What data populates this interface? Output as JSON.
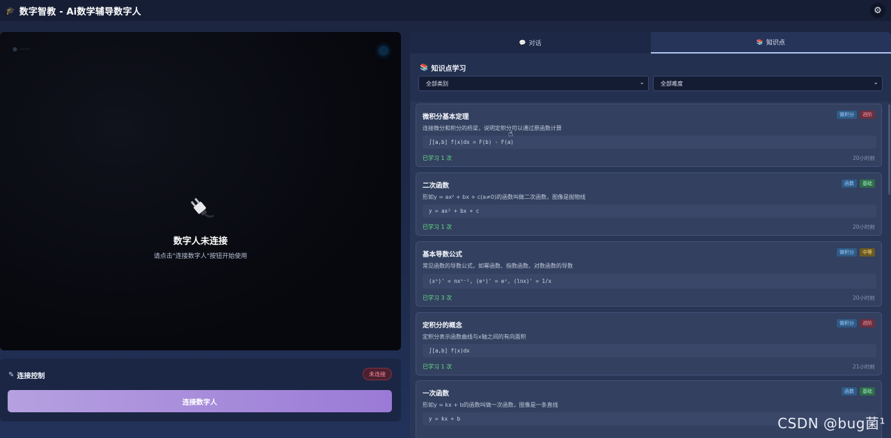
{
  "app": {
    "logo_icon": "graduation-cap-icon",
    "logo_glyph": "🎓",
    "title": "数字智教 - Ai数学辅导数字人",
    "settings_glyph": "⚙"
  },
  "video": {
    "disconnected_title": "数字人未连接",
    "disconnected_hint": "请点击\"连接数字人\"按钮开始使用"
  },
  "connection": {
    "title": "连接控制",
    "status": "未连接",
    "status_color": "#ff8a9a",
    "connect_button": "连接数字人",
    "accent": "#9a7ad6"
  },
  "tabs": [
    {
      "label": "对话",
      "icon": "💬"
    },
    {
      "label": "知识点",
      "icon": "📚",
      "active": true
    }
  ],
  "knowledge": {
    "header": "知识点学习",
    "category_select": "全部类别",
    "difficulty_select": "全部难度",
    "cards": [
      {
        "title": "微积分基本定理",
        "category": "微积分",
        "difficulty": "进阶",
        "description": "连接微分和积分的桥梁，说明定积分可以通过原函数计算",
        "formula": "∫[a,b] f(x)dx = F(b) - F(a)",
        "studied": "已学习 1 次",
        "time": "20小时前"
      },
      {
        "title": "二次函数",
        "category": "函数",
        "difficulty": "基础",
        "description": "形如y = ax² + bx + c(a≠0)的函数叫做二次函数，图像是抛物线",
        "formula": "y = ax² + bx + c",
        "studied": "已学习 1 次",
        "time": "20小时前"
      },
      {
        "title": "基本导数公式",
        "category": "微积分",
        "difficulty": "中等",
        "description": "常见函数的导数公式，如幂函数、指数函数、对数函数的导数",
        "formula": "(xⁿ)' = nxⁿ⁻¹, (eˣ)' = eˣ, (lnx)' = 1/x",
        "studied": "已学习 3 次",
        "time": "20小时前"
      },
      {
        "title": "定积分的概念",
        "category": "微积分",
        "difficulty": "进阶",
        "description": "定积分表示函数曲线与x轴之间的有向面积",
        "formula": "∫[a,b] f(x)dx",
        "studied": "已学习 1 次",
        "time": "21小时前"
      },
      {
        "title": "一次函数",
        "category": "函数",
        "difficulty": "基础",
        "description": "形如y = kx + b的函数叫做一次函数，图像是一条直线",
        "formula": "y = kx + b",
        "studied": "",
        "time": ""
      }
    ]
  },
  "watermark": "CSDN @bug菌¹"
}
